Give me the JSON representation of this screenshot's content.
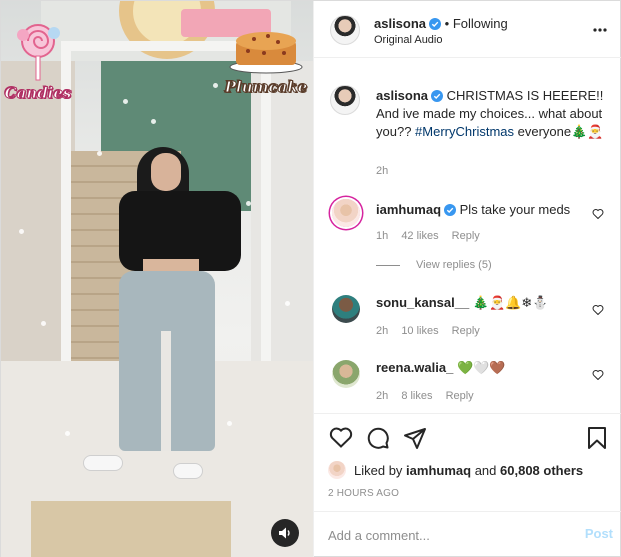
{
  "post": {
    "author": "aslisona",
    "follow_separator": "•",
    "follow_label": "Following",
    "audio_label": "Original Audio",
    "caption_text": "CHRISTMAS IS HEEERE!! And ive made my choices... what about you??",
    "caption_hashtag": "#MerryChristmas",
    "caption_tail": "everyone",
    "caption_emojis": "🎄🎅",
    "caption_time": "2h"
  },
  "stickers": {
    "left_caption": "Candies",
    "right_caption": "Plumcake"
  },
  "comments": [
    {
      "username": "iamhumaq",
      "verified": true,
      "text": "Pls take your meds",
      "time": "1h",
      "likes": "42 likes",
      "reply": "Reply",
      "view_replies": "View replies (5)"
    },
    {
      "username": "sonu_kansal__",
      "verified": false,
      "text": "🎄🎅🔔❄⛄",
      "time": "2h",
      "likes": "10 likes",
      "reply": "Reply"
    },
    {
      "username": "reena.walia_",
      "verified": false,
      "text": "💚🤍🤎",
      "time": "2h",
      "likes": "8 likes",
      "reply": "Reply"
    }
  ],
  "liked_by": {
    "prefix": "Liked by",
    "user": "iamhumaq",
    "middle": "and",
    "others": "60,808 others"
  },
  "timestamp": "2 HOURS AGO",
  "comment_input": {
    "placeholder": "Add a comment...",
    "post_label": "Post"
  },
  "colors": {
    "verified_blue": "#3897f0",
    "hashtag": "#00376b",
    "muted": "#8e8e8e",
    "post_disabled": "#b2dffc"
  }
}
